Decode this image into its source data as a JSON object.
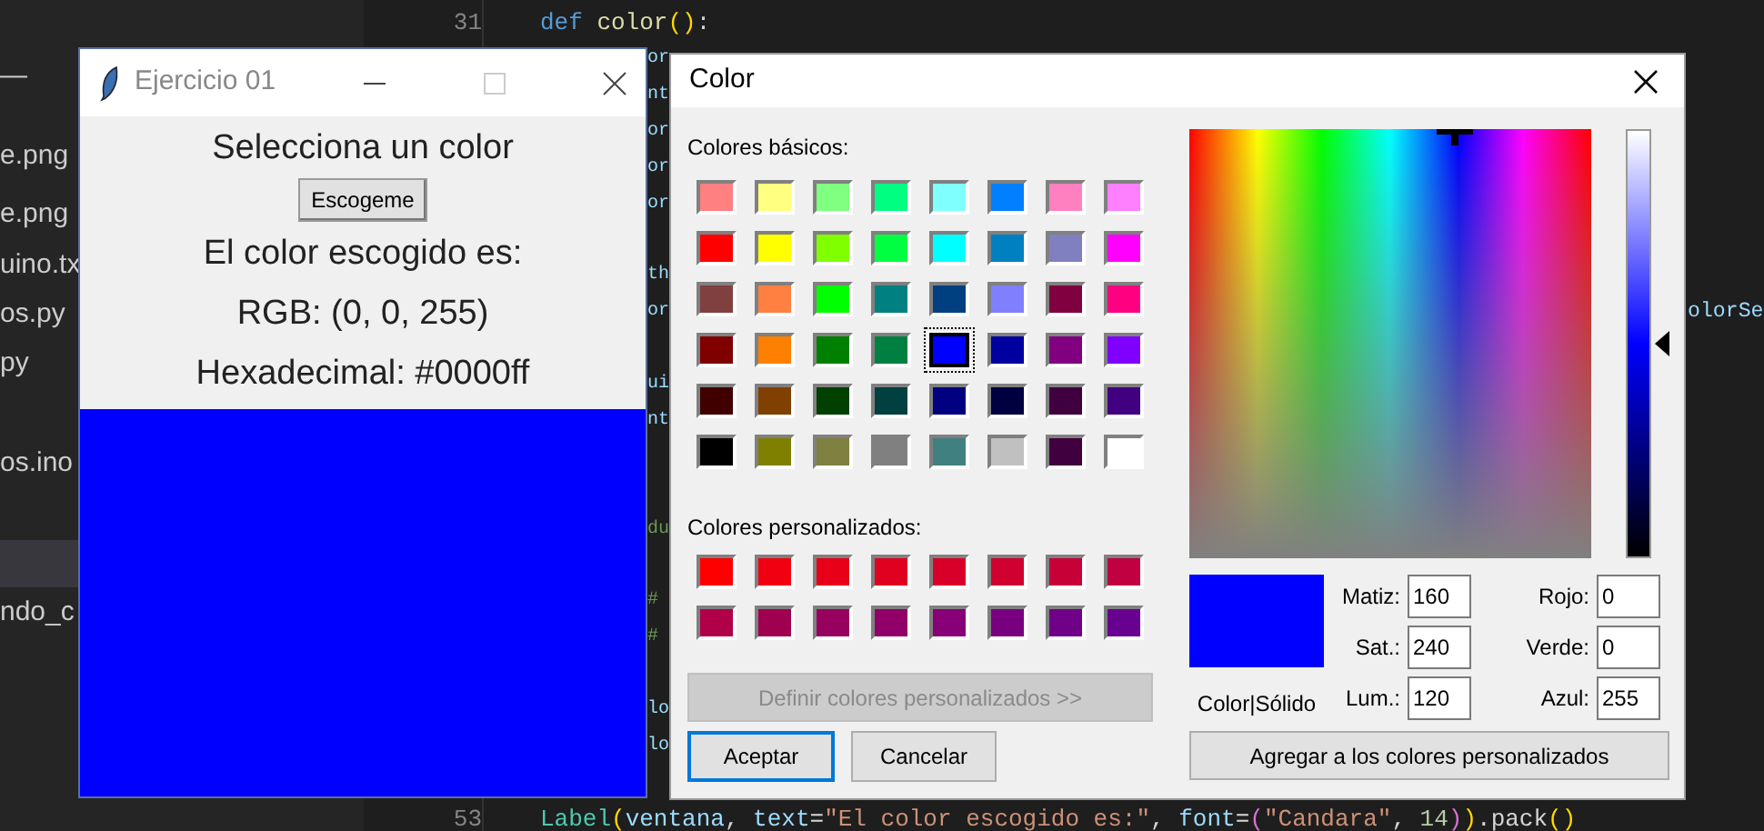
{
  "editor": {
    "sidebar_items": [
      {
        "label": "—",
        "selected": false
      },
      {
        "label": "e.png",
        "selected": false
      },
      {
        "label": "e.png",
        "selected": false
      },
      {
        "label": "uino.tx",
        "selected": false
      },
      {
        "label": "os.py",
        "selected": false
      },
      {
        "label": "py",
        "selected": false
      },
      {
        "label": "os.ino",
        "selected": false
      },
      {
        "selected": true
      },
      {
        "label": "ndo_c",
        "selected": false
      }
    ],
    "line_numbers": [
      "31",
      "53"
    ],
    "top_line": [
      {
        "text": "def",
        "kind": "keyword"
      },
      {
        "text": "color",
        "kind": "function"
      },
      {
        "text": "()",
        "kind": "bracket"
      },
      {
        "text": ":",
        "kind": "plain"
      }
    ],
    "bottom_line": [
      {
        "text": "Label",
        "kind": "class"
      },
      {
        "text": "(",
        "kind": "bracket"
      },
      {
        "text": "ventana",
        "kind": "variable"
      },
      {
        "text": ", ",
        "kind": "plain"
      },
      {
        "text": "text",
        "kind": "variable"
      },
      {
        "text": "=",
        "kind": "plain"
      },
      {
        "text": "\"El color escogido es:\"",
        "kind": "string"
      },
      {
        "text": ", ",
        "kind": "plain"
      },
      {
        "text": "font",
        "kind": "variable"
      },
      {
        "text": "=",
        "kind": "plain"
      },
      {
        "text": "(",
        "kind": "bracket2"
      },
      {
        "text": "\"Candara\"",
        "kind": "string"
      },
      {
        "text": ", ",
        "kind": "plain"
      },
      {
        "text": "14",
        "kind": "number"
      },
      {
        "text": ")",
        "kind": "bracket2"
      },
      {
        "text": ")",
        "kind": "bracket"
      },
      {
        "text": ".pack",
        "kind": "plain"
      },
      {
        "text": "()",
        "kind": "bracket"
      }
    ],
    "strip_fragments": [
      "or",
      "nt",
      "or",
      "or",
      "or",
      "th",
      "or",
      "ui",
      "nt",
      "du",
      "#",
      "#",
      "lo",
      "lo"
    ],
    "right_fragment": "olorSe"
  },
  "tk_window": {
    "title": "Ejercicio 01",
    "heading": "Selecciona un color",
    "button": "Escogeme",
    "result_label": "El color escogido es:",
    "rgb": "RGB: (0, 0, 255)",
    "hex": "Hexadecimal: #0000ff",
    "color": "#0000ff"
  },
  "color_dialog": {
    "title": "Color",
    "basic_label": "Colores básicos:",
    "basic_colors": [
      {
        "color": "#ff8080",
        "selected": false
      },
      {
        "color": "#ffff80",
        "selected": false
      },
      {
        "color": "#80ff80",
        "selected": false
      },
      {
        "color": "#00ff80",
        "selected": false
      },
      {
        "color": "#80ffff",
        "selected": false
      },
      {
        "color": "#0080ff",
        "selected": false
      },
      {
        "color": "#ff80c0",
        "selected": false
      },
      {
        "color": "#ff80ff",
        "selected": false
      },
      {
        "color": "#ff0000",
        "selected": false
      },
      {
        "color": "#ffff00",
        "selected": false
      },
      {
        "color": "#80ff00",
        "selected": false
      },
      {
        "color": "#00ff40",
        "selected": false
      },
      {
        "color": "#00ffff",
        "selected": false
      },
      {
        "color": "#0080c0",
        "selected": false
      },
      {
        "color": "#8080c0",
        "selected": false
      },
      {
        "color": "#ff00ff",
        "selected": false
      },
      {
        "color": "#804040",
        "selected": false
      },
      {
        "color": "#ff8040",
        "selected": false
      },
      {
        "color": "#00ff00",
        "selected": false
      },
      {
        "color": "#008080",
        "selected": false
      },
      {
        "color": "#004080",
        "selected": false
      },
      {
        "color": "#8080ff",
        "selected": false
      },
      {
        "color": "#800040",
        "selected": false
      },
      {
        "color": "#ff0080",
        "selected": false
      },
      {
        "color": "#800000",
        "selected": false
      },
      {
        "color": "#ff8000",
        "selected": false
      },
      {
        "color": "#008000",
        "selected": false
      },
      {
        "color": "#008040",
        "selected": false
      },
      {
        "color": "#0000ff",
        "selected": true
      },
      {
        "color": "#0000a0",
        "selected": false
      },
      {
        "color": "#800080",
        "selected": false
      },
      {
        "color": "#8000ff",
        "selected": false
      },
      {
        "color": "#400000",
        "selected": false
      },
      {
        "color": "#804000",
        "selected": false
      },
      {
        "color": "#004000",
        "selected": false
      },
      {
        "color": "#004040",
        "selected": false
      },
      {
        "color": "#000080",
        "selected": false
      },
      {
        "color": "#000040",
        "selected": false
      },
      {
        "color": "#400040",
        "selected": false
      },
      {
        "color": "#400080",
        "selected": false
      },
      {
        "color": "#000000",
        "selected": false
      },
      {
        "color": "#808000",
        "selected": false
      },
      {
        "color": "#808040",
        "selected": false
      },
      {
        "color": "#808080",
        "selected": false
      },
      {
        "color": "#408080",
        "selected": false
      },
      {
        "color": "#c0c0c0",
        "selected": false
      },
      {
        "color": "#400040",
        "selected": false
      },
      {
        "color": "#ffffff",
        "selected": false
      }
    ],
    "custom_label": "Colores personalizados:",
    "custom_colors": [
      {
        "color": "#ff0000"
      },
      {
        "color": "#f00010"
      },
      {
        "color": "#e80018"
      },
      {
        "color": "#e00020"
      },
      {
        "color": "#d80028"
      },
      {
        "color": "#d00030"
      },
      {
        "color": "#c80038"
      },
      {
        "color": "#c00040"
      },
      {
        "color": "#b00048"
      },
      {
        "color": "#a00050"
      },
      {
        "color": "#980060"
      },
      {
        "color": "#900068"
      },
      {
        "color": "#880078"
      },
      {
        "color": "#780080"
      },
      {
        "color": "#700088"
      },
      {
        "color": "#680090"
      }
    ],
    "define_button": {
      "label": "Definir colores personalizados >>",
      "disabled": true
    },
    "ok_button": "Aceptar",
    "cancel_button": "Cancelar",
    "lum_slider": {
      "level": 0.5
    },
    "preview": {
      "color": "#0000ff",
      "label": "Color|Sólido"
    },
    "fields": [
      {
        "label": "Matiz:",
        "value": "160"
      },
      {
        "label": "Rojo:",
        "value": "0"
      },
      {
        "label": "Sat.:",
        "value": "240"
      },
      {
        "label": "Verde:",
        "value": "0"
      },
      {
        "label": "Lum.:",
        "value": "120"
      },
      {
        "label": "Azul:",
        "value": "255"
      }
    ],
    "add_button": "Agregar a los colores personalizados"
  }
}
